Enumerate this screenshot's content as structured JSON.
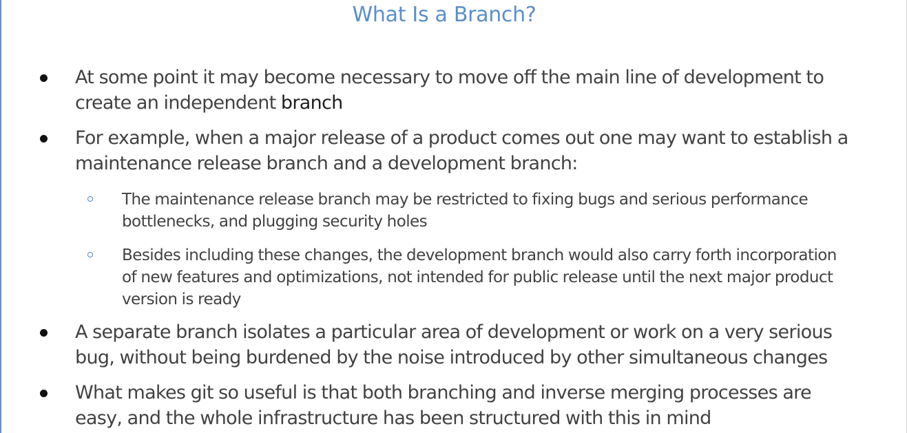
{
  "slide": {
    "title": "What Is a Branch?",
    "bullets": [
      {
        "lines": [
          "At some point it may become necessary to move off the main line of development to",
          "create an independent "
        ],
        "emphasis": "branch"
      },
      {
        "lines": [
          "For example, when a major release of a product comes out one may want to establish a",
          "maintenance release branch and a development branch:"
        ]
      },
      {
        "lines": [
          "A separate branch isolates a particular area of development or work on a very serious",
          "bug, without being burdened by the noise introduced by other simultaneous changes"
        ]
      },
      {
        "lines": [
          "What makes git so useful is that both branching and inverse merging processes are",
          "easy, and the whole infrastructure has been structured with this in mind"
        ]
      }
    ],
    "subbullets": [
      {
        "lines": [
          "The maintenance release branch may be restricted to fixing bugs and serious performance",
          "bottlenecks, and plugging security holes"
        ]
      },
      {
        "lines": [
          "Besides including these changes, the development branch would also carry forth incorporation",
          "of new features and optimizations, not intended for public release until the next major product",
          "version is ready"
        ]
      }
    ]
  }
}
